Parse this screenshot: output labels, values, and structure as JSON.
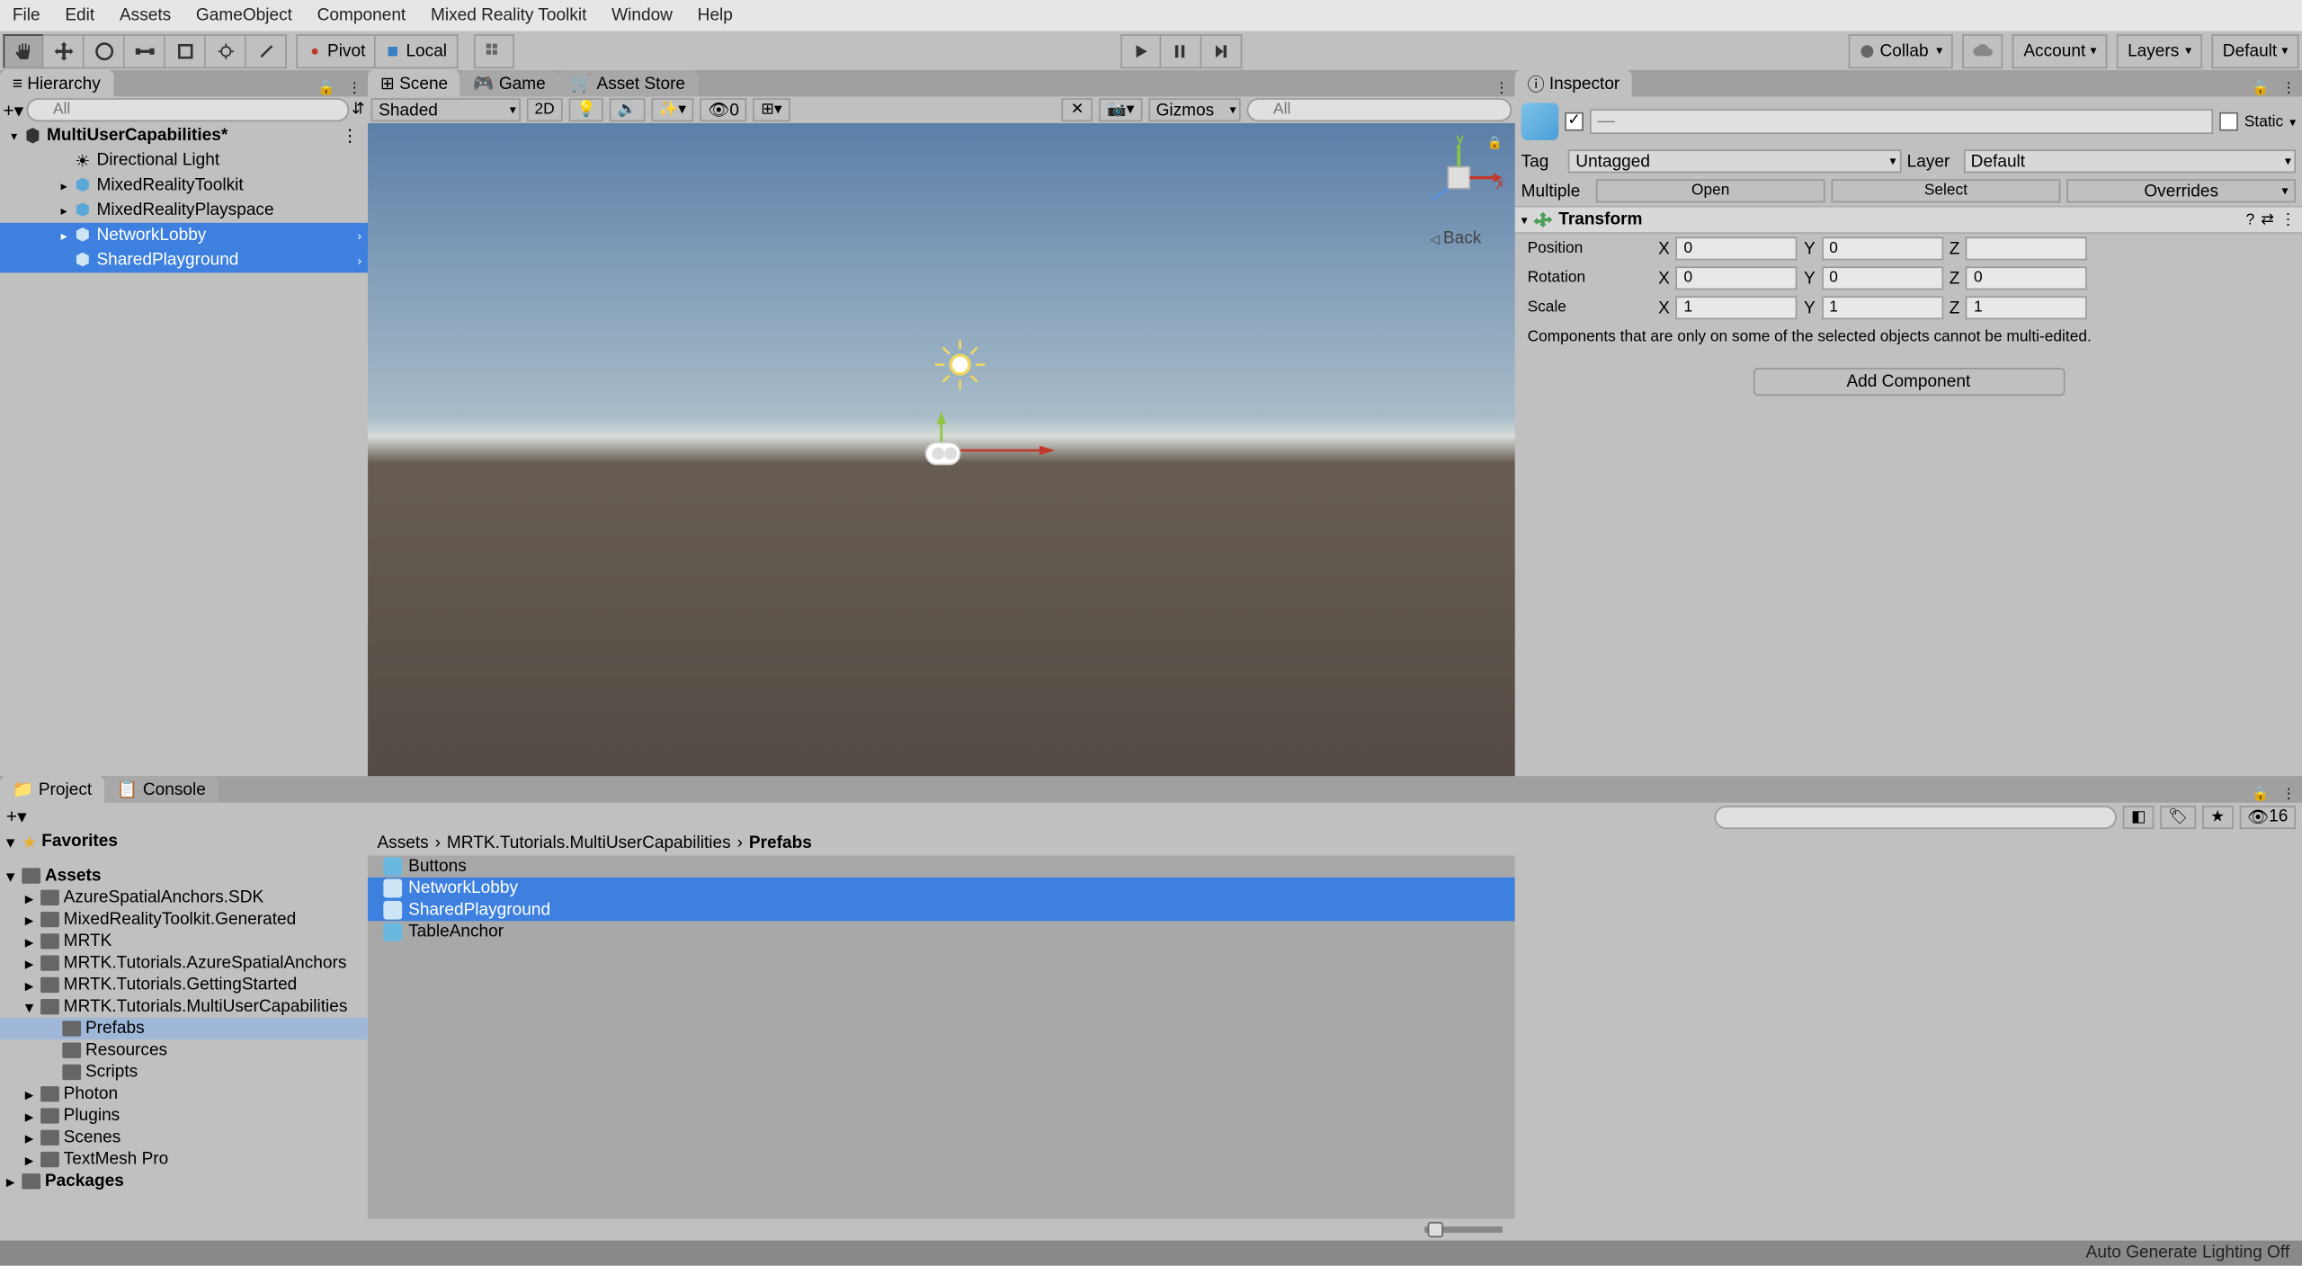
{
  "menu": [
    "File",
    "Edit",
    "Assets",
    "GameObject",
    "Component",
    "Mixed Reality Toolkit",
    "Window",
    "Help"
  ],
  "toolbar": {
    "pivot": "Pivot",
    "local": "Local",
    "collab": "Collab",
    "account": "Account",
    "layers": "Layers",
    "layout": "Default"
  },
  "hierarchy": {
    "title": "Hierarchy",
    "search_placeholder": "All",
    "scene_name": "MultiUserCapabilities*",
    "items": [
      "Directional Light",
      "MixedRealityToolkit",
      "MixedRealityPlayspace",
      "NetworkLobby",
      "SharedPlayground"
    ]
  },
  "scene_tabs": {
    "scene": "Scene",
    "game": "Game",
    "asset_store": "Asset Store"
  },
  "scene_toolbar": {
    "shaded": "Shaded",
    "mode_2d": "2D",
    "hidden_count": "0",
    "gizmos": "Gizmos",
    "search_placeholder": "All",
    "back": "Back"
  },
  "inspector": {
    "title": "Inspector",
    "name_placeholder": "—",
    "static": "Static",
    "tag_label": "Tag",
    "tag_value": "Untagged",
    "layer_label": "Layer",
    "layer_value": "Default",
    "multiple": "Multiple",
    "open": "Open",
    "select": "Select",
    "overrides": "Overrides",
    "transform": "Transform",
    "position": "Position",
    "rotation": "Rotation",
    "scale": "Scale",
    "pos": {
      "x": "0",
      "y": "0",
      "z": ""
    },
    "rot": {
      "x": "0",
      "y": "0",
      "z": "0"
    },
    "scl": {
      "x": "1",
      "y": "1",
      "z": "1"
    },
    "multi_msg": "Components that are only on some of the selected objects cannot be multi-edited.",
    "add_component": "Add Component"
  },
  "project": {
    "tab_project": "Project",
    "tab_console": "Console",
    "thumb_count": "16",
    "favorites": "Favorites",
    "assets": "Assets",
    "packages": "Packages",
    "tree": [
      "AzureSpatialAnchors.SDK",
      "MixedRealityToolkit.Generated",
      "MRTK",
      "MRTK.Tutorials.AzureSpatialAnchors",
      "MRTK.Tutorials.GettingStarted",
      "MRTK.Tutorials.MultiUserCapabilities"
    ],
    "subfolders": [
      "Prefabs",
      "Resources",
      "Scripts"
    ],
    "tree2": [
      "Photon",
      "Plugins",
      "Scenes",
      "TextMesh Pro"
    ],
    "breadcrumb": [
      "Assets",
      "MRTK.Tutorials.MultiUserCapabilities",
      "Prefabs"
    ],
    "assets_list": [
      "Buttons",
      "NetworkLobby",
      "SharedPlayground",
      "TableAnchor"
    ]
  },
  "status": "Auto Generate Lighting Off"
}
